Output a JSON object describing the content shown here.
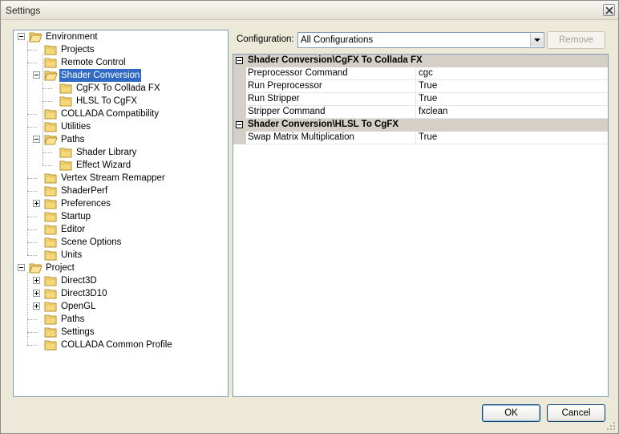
{
  "window": {
    "title": "Settings"
  },
  "tree": {
    "items": [
      {
        "label": "Environment",
        "expander": "minus"
      },
      {
        "label": "Projects"
      },
      {
        "label": "Remote Control"
      },
      {
        "label": "Shader Conversion",
        "expander": "minus",
        "selected": true
      },
      {
        "label": "CgFX To Collada FX"
      },
      {
        "label": "HLSL To CgFX"
      },
      {
        "label": "COLLADA Compatibility"
      },
      {
        "label": "Utilities"
      },
      {
        "label": "Paths",
        "expander": "minus"
      },
      {
        "label": "Shader Library"
      },
      {
        "label": "Effect Wizard"
      },
      {
        "label": "Vertex Stream Remapper"
      },
      {
        "label": "ShaderPerf"
      },
      {
        "label": "Preferences",
        "expander": "plus"
      },
      {
        "label": "Startup"
      },
      {
        "label": "Editor"
      },
      {
        "label": "Scene Options"
      },
      {
        "label": "Units"
      },
      {
        "label": "Project",
        "expander": "minus"
      },
      {
        "label": "Direct3D",
        "expander": "plus"
      },
      {
        "label": "Direct3D10",
        "expander": "plus"
      },
      {
        "label": "OpenGL",
        "expander": "plus"
      },
      {
        "label": "Paths"
      },
      {
        "label": "Settings"
      },
      {
        "label": "COLLADA Common Profile"
      }
    ]
  },
  "config": {
    "label": "Configuration:",
    "value": "All Configurations",
    "remove_label": "Remove"
  },
  "grid": {
    "categories": [
      {
        "title": "Shader Conversion\\CgFX To Collada FX",
        "rows": [
          {
            "name": "Preprocessor Command",
            "value": "cgc"
          },
          {
            "name": "Run Preprocessor",
            "value": "True"
          },
          {
            "name": "Run Stripper",
            "value": "True"
          },
          {
            "name": "Stripper Command",
            "value": "fxclean"
          }
        ]
      },
      {
        "title": "Shader Conversion\\HLSL To CgFX",
        "rows": [
          {
            "name": "Swap Matrix Multiplication",
            "value": "True"
          }
        ]
      }
    ]
  },
  "buttons": {
    "ok": "OK",
    "cancel": "Cancel"
  },
  "colors": {
    "selection": "#316ac5",
    "category_bg": "#d4d0c8",
    "border": "#7f9db9"
  }
}
